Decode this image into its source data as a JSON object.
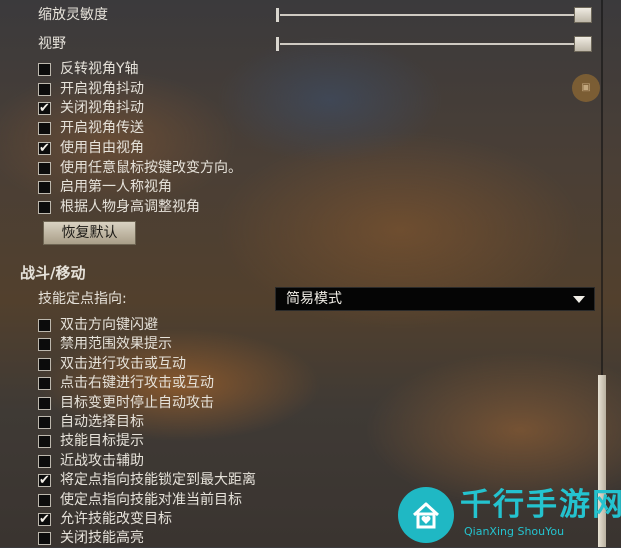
{
  "sliders": [
    {
      "label": "缩放灵敏度",
      "value_fraction": 1.0
    },
    {
      "label": "视野",
      "value_fraction": 1.0
    }
  ],
  "camera_options": [
    {
      "label": "反转视角Y轴",
      "checked": false
    },
    {
      "label": "开启视角抖动",
      "checked": false
    },
    {
      "label": "关闭视角抖动",
      "checked": true
    },
    {
      "label": "开启视角传送",
      "checked": false
    },
    {
      "label": "使用自由视角",
      "checked": true
    },
    {
      "label": "使用任意鼠标按键改变方向。",
      "checked": false
    },
    {
      "label": "启用第一人称视角",
      "checked": false
    },
    {
      "label": "根据人物身高调整视角",
      "checked": false
    }
  ],
  "reset_button": "恢复默认",
  "combat_section": {
    "title": "战斗/移动",
    "field_label": "技能定点指向:",
    "dropdown_value": "简易模式"
  },
  "combat_options": [
    {
      "label": "双击方向键闪避",
      "checked": false
    },
    {
      "label": "禁用范围效果提示",
      "checked": false
    },
    {
      "label": "双击进行攻击或互动",
      "checked": false
    },
    {
      "label": "点击右键进行攻击或互动",
      "checked": false
    },
    {
      "label": "目标变更时停止自动攻击",
      "checked": false
    },
    {
      "label": "自动选择目标",
      "checked": false
    },
    {
      "label": "技能目标提示",
      "checked": false
    },
    {
      "label": "近战攻击辅助",
      "checked": false
    },
    {
      "label": "将定点指向技能锁定到最大距离",
      "checked": true
    },
    {
      "label": "使定点指向技能对准当前目标",
      "checked": false
    },
    {
      "label": "允许技能改变目标",
      "checked": true
    },
    {
      "label": "关闭技能高亮",
      "checked": false
    }
  ],
  "check_glyph": "✔",
  "watermark": {
    "title": "千行手游网",
    "subtitle": "QianXing ShouYou",
    "color": "#24c3cf"
  },
  "scrollbar": {
    "position_fraction": 1.0
  }
}
